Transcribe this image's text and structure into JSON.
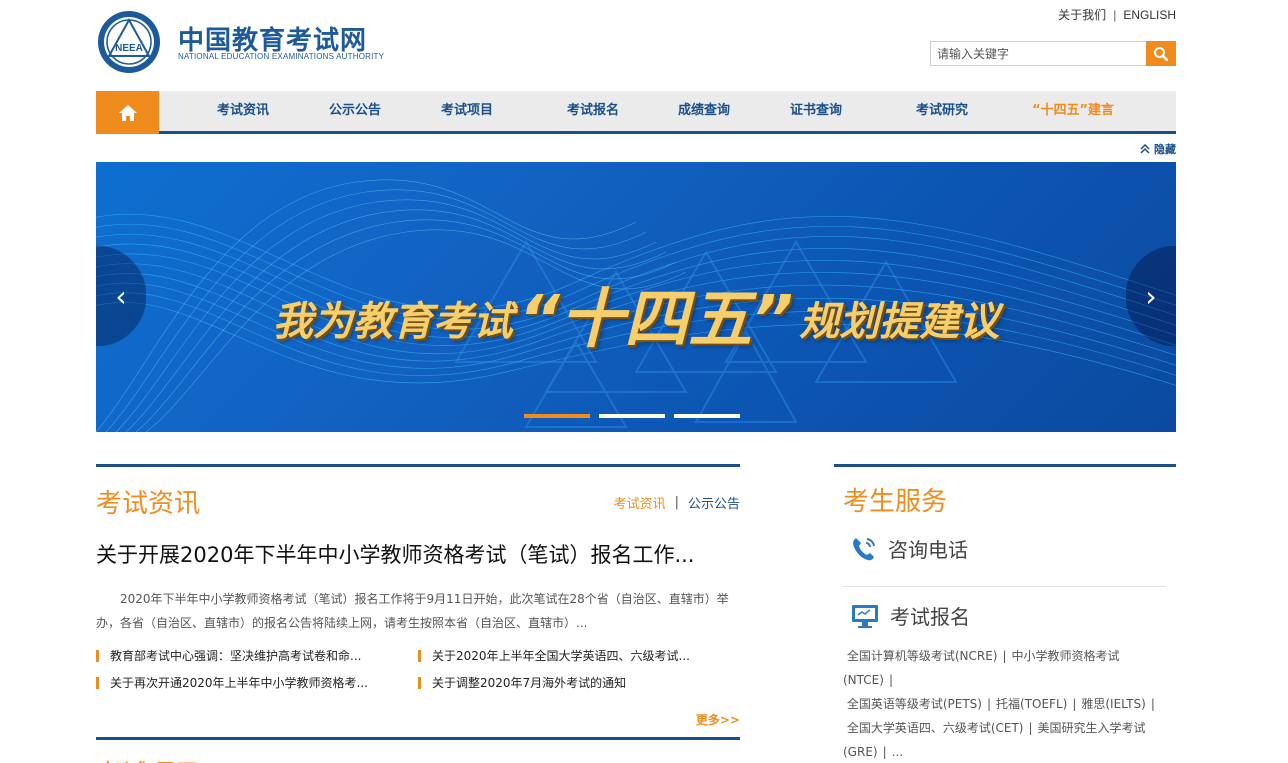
{
  "header": {
    "logo_text": "NEEA",
    "title": "中国教育考试网",
    "subtitle": "NATIONAL EDUCATION EXAMINATIONS AUTHORITY",
    "about": "关于我们",
    "english": "ENGLISH",
    "search_placeholder": "请输入关键字"
  },
  "nav": {
    "items": [
      "考试资讯",
      "公示公告",
      "考试项目",
      "考试报名",
      "成绩查询",
      "证书查询",
      "考试研究",
      "“十四五”建言"
    ]
  },
  "hide_label": "隐藏",
  "banner": {
    "slogan_left": "我为教育考试",
    "slogan_mid": "“十四五”",
    "slogan_right": "规划提建议",
    "slide_count": 3,
    "active_slide": 1
  },
  "news": {
    "title": "考试资讯",
    "tab_active": "考试资讯",
    "tab_other": "公示公告",
    "headline": "关于开展2020年下半年中小学教师资格考试（笔试）报名工作...",
    "summary": "2020年下半年中小学教师资格考试（笔试）报名工作将于9月11日开始，此次笔试在28个省（自治区、直辖市）举办，各省（自治区、直辖市）的报名公告将陆续上网，请考生按照本省（自治区、直辖市）...",
    "items": [
      "教育部考试中心强调：坚决维护高考试卷和命...",
      "关于2020年上半年全国大学英语四、六级考试...",
      "关于再次开通2020年上半年中小学教师资格考...",
      "关于调整2020年7月海外考试的通知"
    ],
    "more": "更多>>"
  },
  "next_section": {
    "title": "考试项目"
  },
  "service": {
    "title": "考生服务",
    "hotline": "咨询电话",
    "signup": "考试报名",
    "exam_links": [
      "全国计算机等级考试(NCRE)",
      "中小学教师资格考试(NTCE)",
      "全国英语等级考试(PETS)",
      "托福(TOEFL)",
      "雅思(IELTS)",
      "全国大学英语四、六级考试(CET)",
      "美国研究生入学考试(GRE)",
      "..."
    ]
  },
  "colors": {
    "brand_blue": "#1b4f89",
    "accent_orange": "#f08c1e"
  }
}
